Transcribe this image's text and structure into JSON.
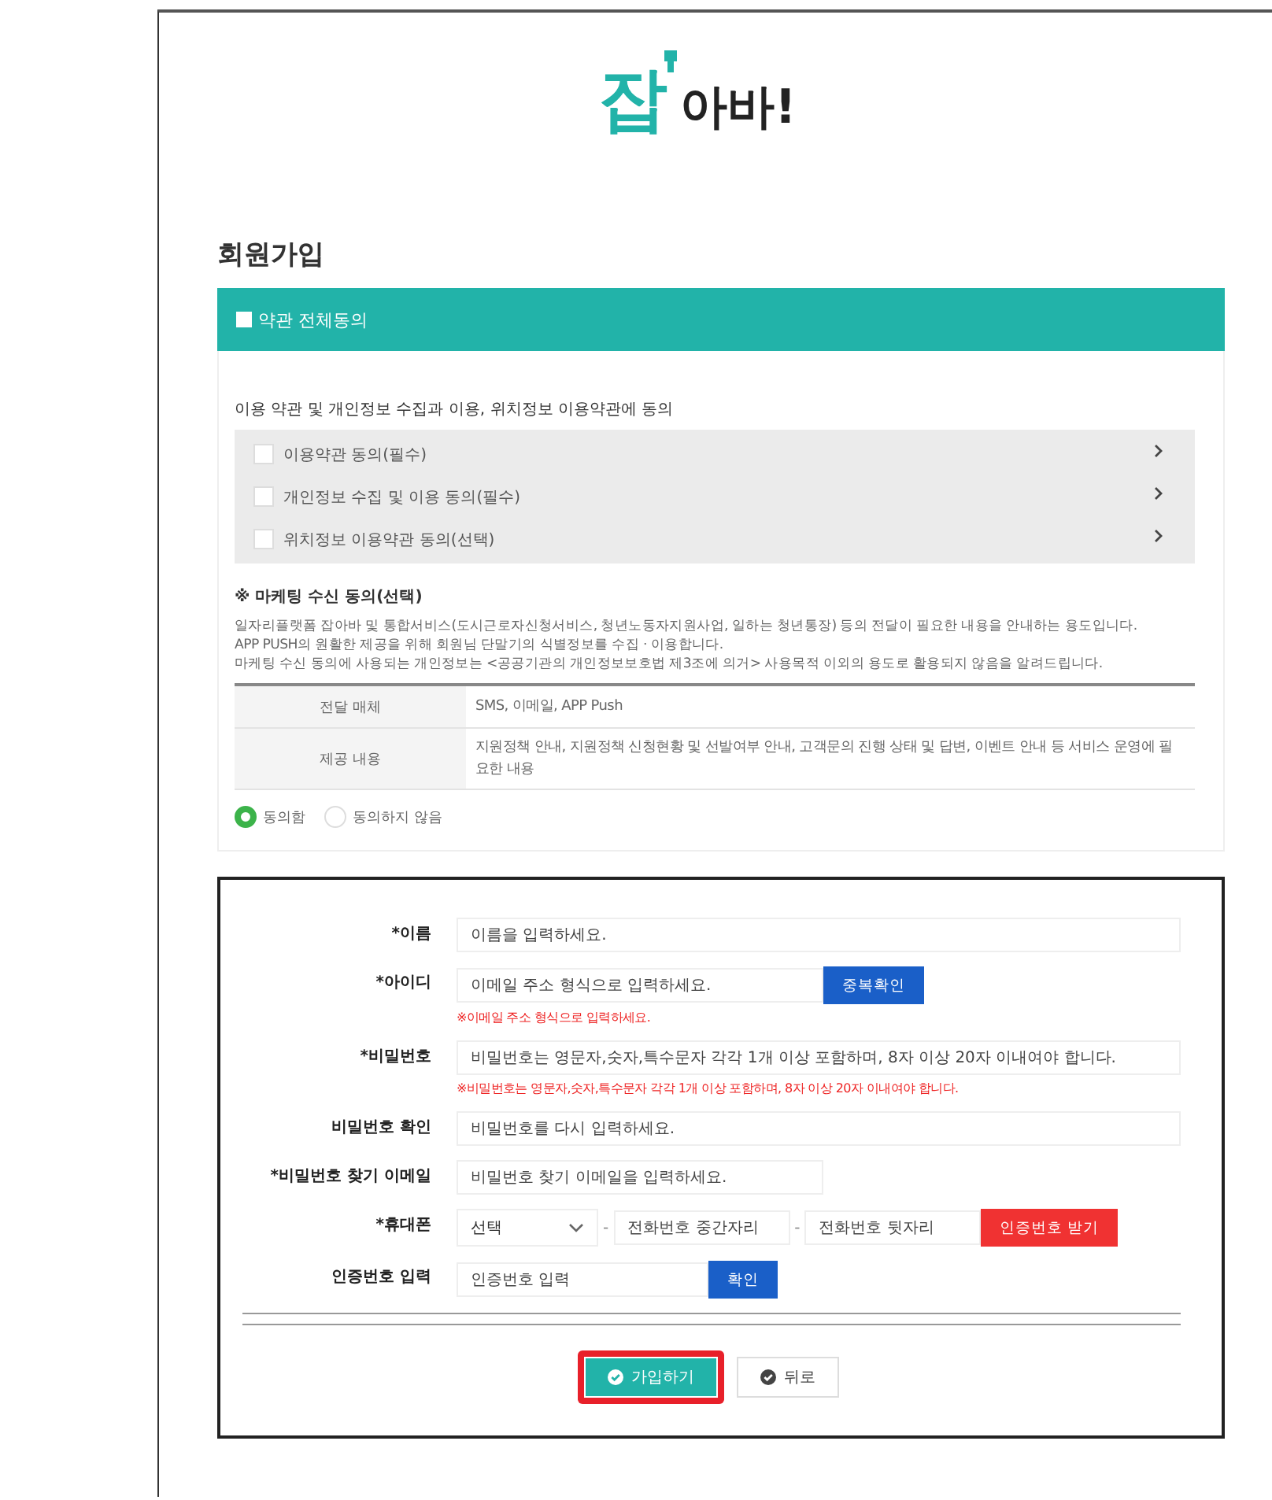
{
  "logo": {
    "accent": "잡",
    "rest": "아바!"
  },
  "title": "회원가입",
  "agree_all": {
    "label": "약관 전체동의",
    "checked": false
  },
  "terms_intro": "이용 약관 및 개인정보 수집과 이용, 위치정보 이용약관에 동의",
  "terms": [
    {
      "label": "이용약관 동의(필수)",
      "checked": false
    },
    {
      "label": "개인정보 수집 및 이용 동의(필수)",
      "checked": false
    },
    {
      "label": "위치정보 이용약관 동의(선택)",
      "checked": false
    }
  ],
  "marketing": {
    "heading": "※ 마케팅 수신 동의(선택)",
    "lines": [
      "일자리플랫폼 잡아바 및 통합서비스(도시근로자신청서비스, 청년노동자지원사업, 일하는 청년통장) 등의 전달이 필요한 내용을 안내하는 용도입니다.",
      "APP PUSH의 원활한 제공을 위해 회원님 단말기의 식별정보를 수집 · 이용합니다.",
      "마케팅 수신 동의에 사용되는 개인정보는 <공공기관의 개인정보보호법 제3조에 의거> 사용목적 이외의 용도로 활용되지 않음을 알려드립니다."
    ],
    "table": [
      {
        "header": "전달 매체",
        "value": "SMS, 이메일, APP Push"
      },
      {
        "header": "제공 내용",
        "value": "지원정책 안내, 지원정책 신청현황 및 선발여부 안내, 고객문의 진행 상태 및 답변, 이벤트 안내 등 서비스 운영에 필요한 내용"
      }
    ],
    "options": [
      {
        "label": "동의함",
        "selected": true
      },
      {
        "label": "동의하지 않음",
        "selected": false
      }
    ]
  },
  "form": [
    {
      "kind": "text",
      "label": "*이름",
      "placeholder": "이름을 입력하세요."
    },
    {
      "kind": "short",
      "label": "*아이디",
      "placeholder": "이메일 주소 형식으로 입력하세요.",
      "button": {
        "label": "중복확인",
        "color": "#1a5fc8"
      },
      "error": "※이메일 주소 형식으로 입력하세요."
    },
    {
      "kind": "text",
      "label": "*비밀번호",
      "placeholder": "비밀번호는 영문자,숫자,특수문자 각각 1개 이상 포함하며, 8자 이상 20자 이내여야 합니다.",
      "error": "※비밀번호는 영문자,숫자,특수문자 각각 1개 이상 포함하며, 8자 이상 20자 이내여야 합니다."
    },
    {
      "kind": "text",
      "label": "비밀번호 확인",
      "placeholder": "비밀번호를 다시 입력하세요."
    },
    {
      "kind": "short",
      "label": "*비밀번호 찾기 이메일",
      "placeholder": "비밀번호 찾기 이메일을 입력하세요."
    },
    {
      "kind": "phone",
      "label": "*휴대폰",
      "select": "선택",
      "parts": [
        {
          "separator": "-",
          "placeholder": "전화번호 중간자리"
        },
        {
          "separator": "-",
          "placeholder": "전화번호 뒷자리"
        }
      ],
      "button": {
        "label": "인증번호 받기",
        "color": "#f03232"
      }
    },
    {
      "kind": "code",
      "label": "인증번호 입력",
      "placeholder": "인증번호 입력",
      "button": {
        "label": "확인",
        "color": "#1a5fc8"
      }
    }
  ],
  "actions": [
    {
      "label": "가입하기",
      "kind": "primary",
      "highlighted": true
    },
    {
      "label": "뒤로",
      "kind": "secondary",
      "highlighted": false
    }
  ]
}
